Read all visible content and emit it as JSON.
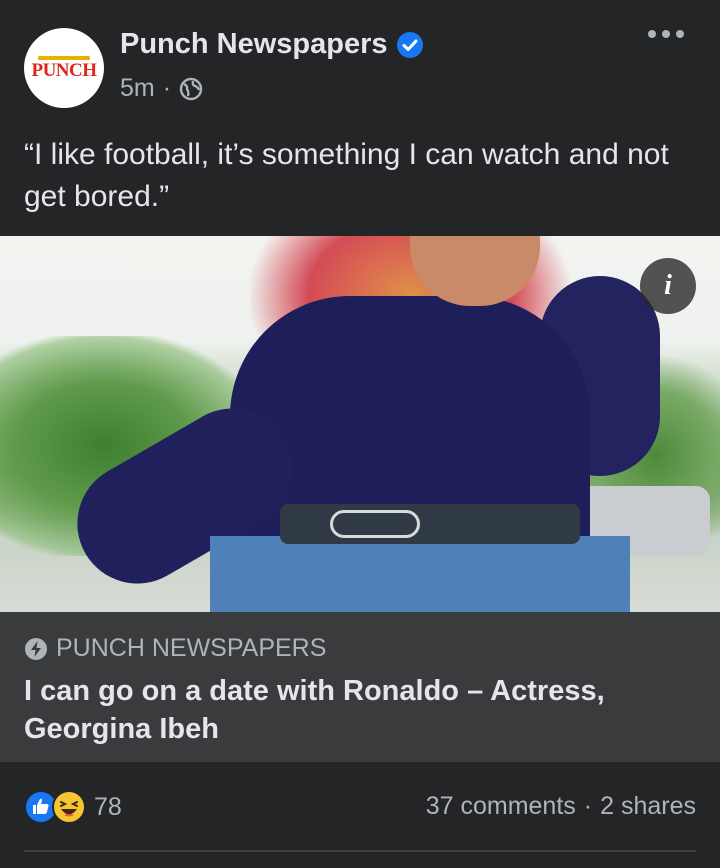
{
  "post": {
    "page_name": "Punch Newspapers",
    "avatar_text": "PUNCH",
    "time": "5m",
    "separator": "·",
    "text": "“I like football, it’s something I can watch and not get bored.”"
  },
  "photo": {
    "info_label": "i"
  },
  "link_preview": {
    "source": "PUNCH NEWSPAPERS",
    "headline": "I can go on a date with Ronaldo – Actress, Georgina Ibeh"
  },
  "footer": {
    "reaction_count": "78",
    "comments": "37 comments",
    "dot": "·",
    "shares": "2 shares"
  },
  "icons": {
    "verified": "verified-badge-icon",
    "privacy": "globe-icon",
    "more": "more-horizontal-icon",
    "source": "lightning-bolt-icon",
    "like": "like-reaction-icon",
    "haha": "haha-reaction-icon"
  },
  "colors": {
    "background": "#242526",
    "preview_background": "#3a3b3c",
    "primary_text": "#e4e6eb",
    "secondary_text": "#b0b3b8",
    "verified_blue": "#1877f2",
    "brand_red": "#e0261a"
  }
}
